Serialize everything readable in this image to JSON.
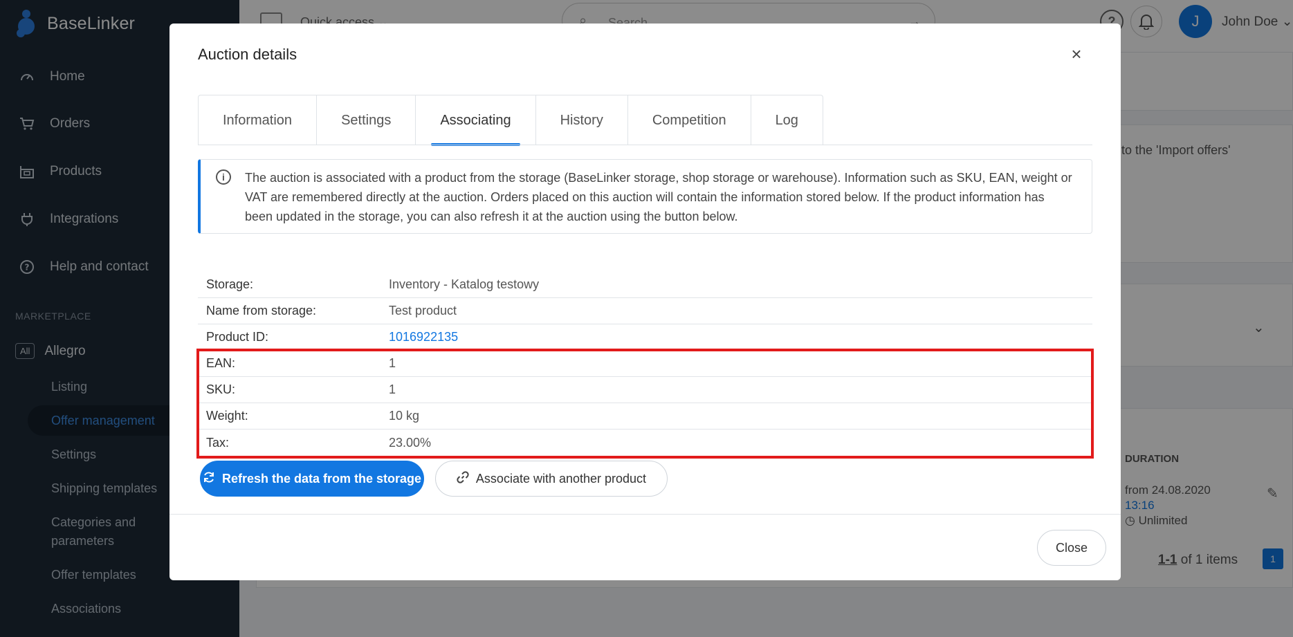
{
  "sidebar": {
    "logo_text": "BaseLinker",
    "nav": [
      {
        "label": "Home",
        "icon": "gauge-icon"
      },
      {
        "label": "Orders",
        "icon": "cart-icon"
      },
      {
        "label": "Products",
        "icon": "products-icon"
      },
      {
        "label": "Integrations",
        "icon": "plug-icon"
      },
      {
        "label": "Help and contact",
        "icon": "help-icon"
      }
    ],
    "section_label": "MARKETPLACE",
    "market_badge": "All",
    "market_name": "Allegro",
    "sub_items": [
      "Listing",
      "Offer management",
      "Settings",
      "Shipping templates",
      "Categories and parameters",
      "Offer templates",
      "Associations"
    ],
    "active_sub": "Offer management"
  },
  "topbar": {
    "quick_access": "Quick access",
    "search_placeholder": "Search",
    "user_initial": "J",
    "user_name": "John Doe"
  },
  "background": {
    "import_hint": "to the 'Import offers'",
    "duration_header": "DURATION",
    "duration_from": "from 24.08.2020",
    "duration_time": "13:16",
    "duration_unlimited": "Unlimited",
    "pagination_range": "1-1",
    "pagination_total": "of 1 items",
    "page_number": "1"
  },
  "modal": {
    "title": "Auction details",
    "tabs": [
      "Information",
      "Settings",
      "Associating",
      "History",
      "Competition",
      "Log"
    ],
    "active_tab": "Associating",
    "info_text": "The auction is associated with a product from the storage (BaseLinker storage, shop storage or warehouse). Information such as SKU, EAN, weight or VAT are remembered directly at the auction. Orders placed on this auction will contain the information stored below. If the product information has been updated in the storage, you can also refresh it at the auction using the button below.",
    "details": [
      {
        "key": "Storage:",
        "value": "Inventory - Katalog testowy"
      },
      {
        "key": "Name from storage:",
        "value": "Test product"
      },
      {
        "key": "Product ID:",
        "value": "1016922135"
      },
      {
        "key": "EAN:",
        "value": "1"
      },
      {
        "key": "SKU:",
        "value": "1"
      },
      {
        "key": "Weight:",
        "value": "10 kg"
      },
      {
        "key": "Tax:",
        "value": "23.00%"
      }
    ],
    "refresh_button": "Refresh the data from the storage",
    "associate_button": "Associate with another product",
    "close_button": "Close"
  }
}
